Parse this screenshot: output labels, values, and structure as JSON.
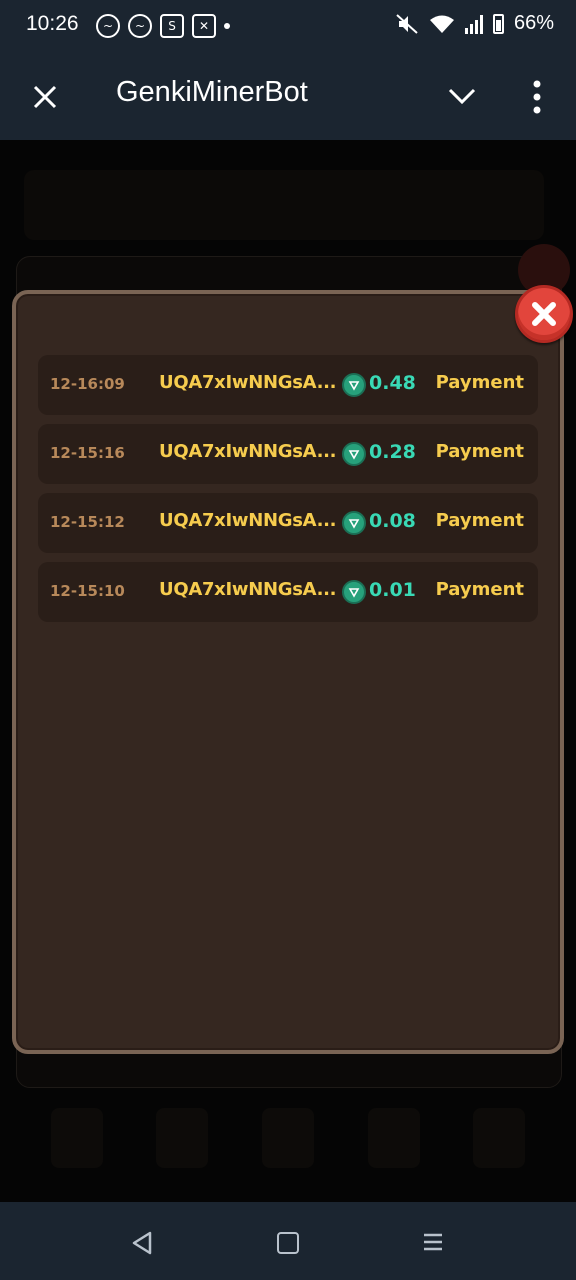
{
  "status_bar": {
    "time": "10:26",
    "battery": "66%",
    "icons": [
      "messenger-icon",
      "messenger-icon",
      "shopee-icon",
      "capcut-icon",
      "dot-icon",
      "mute-icon",
      "wifi-icon",
      "signal-icon",
      "battery-icon"
    ]
  },
  "app_bar": {
    "title": "GenkiMinerBot"
  },
  "modal": {
    "rows": [
      {
        "time": "12-16:09",
        "address": "UQA7xIwNNGsA...",
        "amount": "0.48",
        "type": "Payment"
      },
      {
        "time": "12-15:16",
        "address": "UQA7xIwNNGsA...",
        "amount": "0.28",
        "type": "Payment"
      },
      {
        "time": "12-15:12",
        "address": "UQA7xIwNNGsA...",
        "amount": "0.08",
        "type": "Payment"
      },
      {
        "time": "12-15:10",
        "address": "UQA7xIwNNGsA...",
        "amount": "0.01",
        "type": "Payment"
      }
    ]
  },
  "colors": {
    "modal_bg": "#352720",
    "modal_border": "#7a6454",
    "address": "#f6cc4e",
    "amount": "#39d9b5",
    "time": "#b8895a",
    "close_button": "#e2453c"
  }
}
